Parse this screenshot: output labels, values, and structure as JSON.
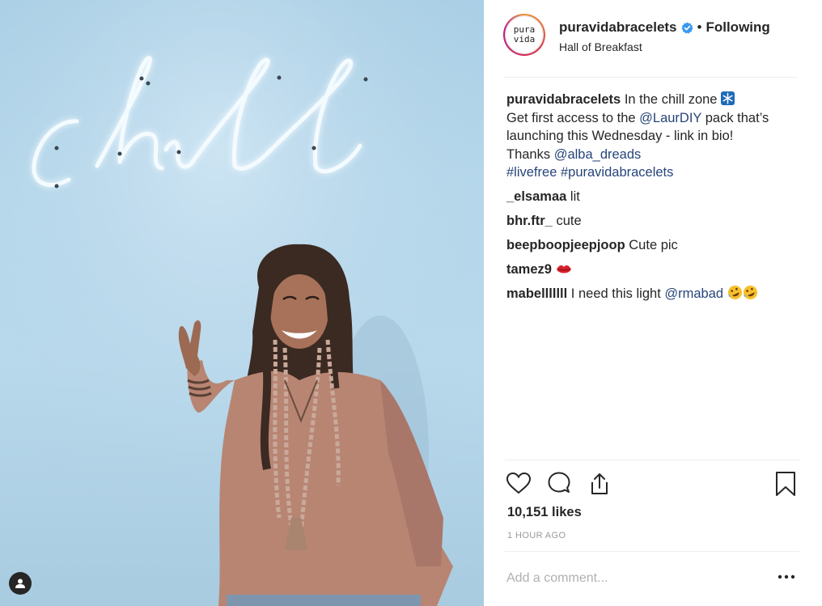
{
  "header": {
    "avatar_line1": "pura",
    "avatar_line2": "vida",
    "username": "puravidabracelets",
    "separator": "•",
    "follow_status": "Following",
    "location": "Hall of Breakfast"
  },
  "caption": {
    "username": "puravidabracelets",
    "text1": "In the chill zone",
    "text2": "Get first access to the",
    "mention1": "@LaurDIY",
    "text3": "pack that’s launching this Wednesday - link in bio!",
    "text4": "Thanks",
    "mention2": "@alba_dreads",
    "hashtag1": "#livefree",
    "hashtag2": "#puravidabracelets"
  },
  "comments": [
    {
      "username": "_elsamaa",
      "text": "lit"
    },
    {
      "username": "bhr.ftr_",
      "text": "cute"
    },
    {
      "username": "beepboopjeepjoop",
      "text": "Cute pic"
    },
    {
      "username": "tamez9",
      "text": ""
    },
    {
      "username": "mabelllllll",
      "text": "I need this light",
      "mention": "@rmabad"
    }
  ],
  "photo": {
    "neon_text": "chill"
  },
  "likes": "10,151 likes",
  "timestamp": "1 HOUR AGO",
  "add_comment_placeholder": "Add a comment...",
  "colors": {
    "link": "#27457a",
    "verified": "#3897f0",
    "border": "#efefef"
  }
}
